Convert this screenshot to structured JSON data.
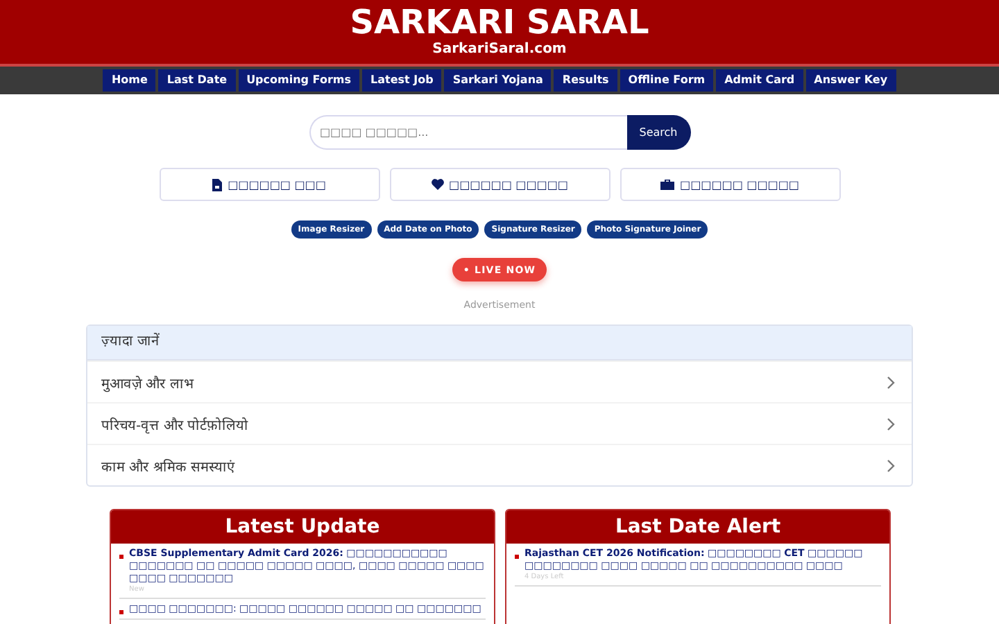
{
  "header": {
    "title": "SARKARI SARAL",
    "subtitle": "SarkariSaral.com"
  },
  "nav": [
    "Home",
    "Last Date",
    "Upcoming Forms",
    "Latest Job",
    "Sarkari Yojana",
    "Results",
    "Offline Form",
    "Admit Card",
    "Answer Key"
  ],
  "search": {
    "placeholder": "□□□□ □□□□□...",
    "button": "Search"
  },
  "quick_links": [
    {
      "kind": "file",
      "label": "□□□□□□ □□□"
    },
    {
      "kind": "heart",
      "label": "□□□□□□ □□□□□"
    },
    {
      "kind": "briefcase",
      "label": "□□□□□□ □□□□□"
    }
  ],
  "tools": [
    "Image Resizer",
    "Add Date on Photo",
    "Signature Resizer",
    "Photo Signature Joiner"
  ],
  "live_button": "• LIVE NOW",
  "ad_label": "Advertisement",
  "accordion": {
    "title": "ज़्यादा जानें",
    "items": [
      "मुआवज़े और लाभ",
      "परिचय-वृत्त और पोर्टफ़ोलियो",
      "काम और श्रमिक समस्याएं"
    ]
  },
  "panels": [
    {
      "title": "Latest Update",
      "items": [
        {
          "text": "**CBSE Supplementary Admit Card 2026:** □□□□□□□□□□□ □□□□□□□ □□ □□□□□ □□□□□ □□□□, □□□□ □□□□□ □□□□ □□□□ □□□□□□□",
          "note": "New"
        },
        {
          "text": "□□□□ □□□□□□□: □□□□□ □□□□□□ □□□□□ □□ □□□□□□□"
        }
      ]
    },
    {
      "title": "Last Date Alert",
      "items": [
        {
          "text": "**Rajasthan CET 2026 Notification:** □□□□□□□□ **CET** □□□□□□ □□□□□□□□ □□□□ □□□□□ □□ □□□□□□□□□□ □□□□",
          "note": "4 Days Left"
        }
      ]
    }
  ]
}
